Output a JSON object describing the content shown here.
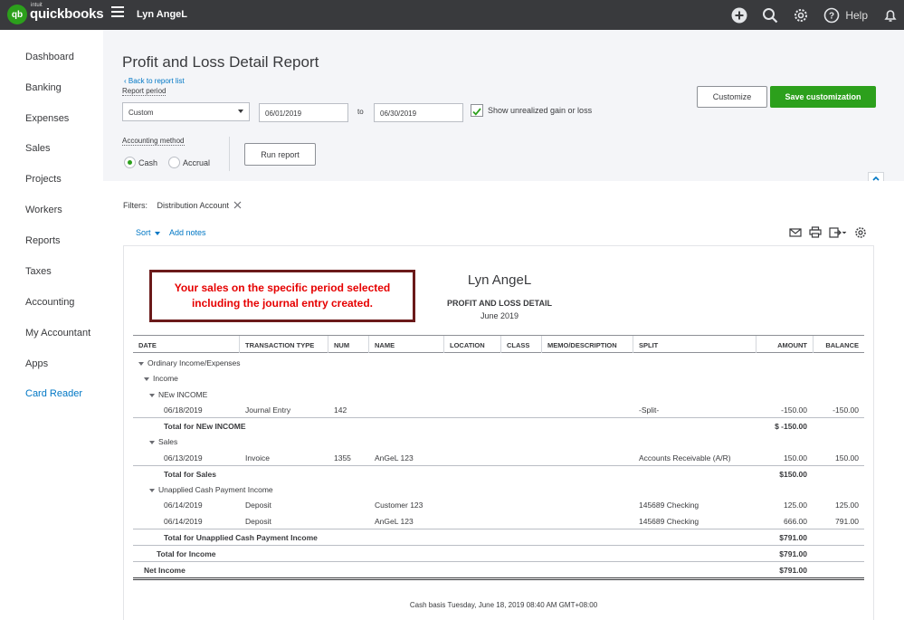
{
  "app": {
    "logo_small": "intuit",
    "logo_name": "quickbooks",
    "logo_mark": "qb",
    "company": "Lyn AngeL",
    "help": "Help"
  },
  "sidebar": {
    "items": [
      "Dashboard",
      "Banking",
      "Expenses",
      "Sales",
      "Projects",
      "Workers",
      "Reports",
      "Taxes",
      "Accounting",
      "My Accountant",
      "Apps",
      "Card Reader"
    ]
  },
  "page": {
    "title": "Profit and Loss Detail Report",
    "back_link": "Back to report list",
    "report_period_label": "Report period",
    "period_select": "Custom",
    "date_from": "06/01/2019",
    "to_label": "to",
    "date_to": "06/30/2019",
    "unrealized_label": "Show unrealized gain or loss",
    "customize_label": "Customize",
    "save_customization_label": "Save customization",
    "accounting_method_label": "Accounting method",
    "cash_label": "Cash",
    "accrual_label": "Accrual",
    "run_report_label": "Run report"
  },
  "filters": {
    "label": "Filters:",
    "chip": "Distribution Account"
  },
  "toolbar": {
    "sort": "Sort",
    "add_notes": "Add notes"
  },
  "callout": {
    "line1": "Your sales on the specific period selected",
    "line2": "including the journal entry created."
  },
  "report": {
    "company": "Lyn AngeL",
    "title": "PROFIT AND LOSS DETAIL",
    "period": "June 2019",
    "columns": [
      "DATE",
      "TRANSACTION TYPE",
      "NUM",
      "NAME",
      "LOCATION",
      "CLASS",
      "MEMO/DESCRIPTION",
      "SPLIT",
      "AMOUNT",
      "BALANCE"
    ],
    "sections": {
      "ordinary": "Ordinary Income/Expenses",
      "income": "Income",
      "new_income": "NEw INCOME",
      "sales": "Sales",
      "unapplied": "Unapplied Cash Payment Income"
    },
    "rows": [
      {
        "date": "06/18/2019",
        "type": "Journal Entry",
        "num": "142",
        "name": "",
        "split": "-Split-",
        "amount": "-150.00",
        "balance": "-150.00"
      },
      {
        "date": "06/13/2019",
        "type": "Invoice",
        "num": "1355",
        "name": "AnGeL 123",
        "split": "Accounts Receivable (A/R)",
        "amount": "150.00",
        "balance": "150.00"
      },
      {
        "date": "06/14/2019",
        "type": "Deposit",
        "num": "",
        "name": "Customer 123",
        "split": "145689 Checking",
        "amount": "125.00",
        "balance": "125.00"
      },
      {
        "date": "06/14/2019",
        "type": "Deposit",
        "num": "",
        "name": "AnGeL 123",
        "split": "145689 Checking",
        "amount": "666.00",
        "balance": "791.00"
      }
    ],
    "totals": {
      "new_income_label": "Total for NEw INCOME",
      "new_income": "$ -150.00",
      "sales_label": "Total for Sales",
      "sales": "$150.00",
      "unapplied_label": "Total for Unapplied Cash Payment Income",
      "unapplied": "$791.00",
      "income_label": "Total for Income",
      "income": "$791.00",
      "net_label": "Net Income",
      "net": "$791.00"
    },
    "footer": "Cash basis  Tuesday, June 18, 2019  08:40 AM GMT+08:00"
  }
}
